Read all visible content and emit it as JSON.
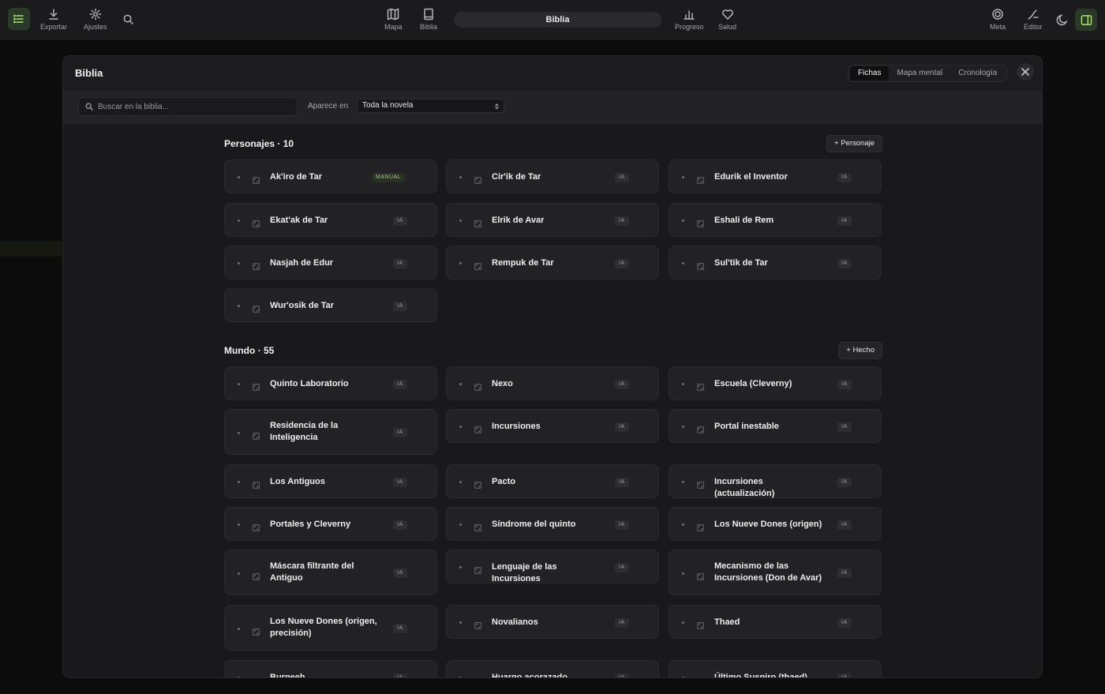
{
  "toolbar": {
    "export_label": "Exportar",
    "settings_label": "Ajustes",
    "map_label": "Mapa",
    "bible_label": "Biblia",
    "document_title": "Biblia",
    "progress_label": "Progreso",
    "health_label": "Salud",
    "goal_label": "Meta",
    "editor_label": "Editor"
  },
  "modal": {
    "title": "Biblia",
    "tabs": [
      "Fichas",
      "Mapa mental",
      "Cronología"
    ],
    "active_tab": "Fichas",
    "search_placeholder": "Buscar en la biblia...",
    "appears_in_label": "Aparece en",
    "appears_in_value": "Toda la novela"
  },
  "sections": [
    {
      "title": "Personajes · 10",
      "add_label": "+ Personaje",
      "cards": [
        {
          "name": "Ak'iro de Tar",
          "badge": "MANUAL"
        },
        {
          "name": "Cir'ik de Tar",
          "badge": "IA"
        },
        {
          "name": "Edurik el Inventor",
          "badge": "IA"
        },
        {
          "name": "Ekat'ak de Tar",
          "badge": "IA"
        },
        {
          "name": "Elrik de Avar",
          "badge": "IA"
        },
        {
          "name": "Eshali de Rem",
          "badge": "IA"
        },
        {
          "name": "Nasjah de Edur",
          "badge": "IA"
        },
        {
          "name": "Rempuk de Tar",
          "badge": "IA"
        },
        {
          "name": "Sul'tik de Tar",
          "badge": "IA"
        },
        {
          "name": "Wur'osik de Tar",
          "badge": "IA"
        }
      ]
    },
    {
      "title": "Mundo · 55",
      "add_label": "+ Hecho",
      "cards": [
        {
          "name": "Quinto Laboratorio",
          "badge": "IA"
        },
        {
          "name": "Nexo",
          "badge": "IA"
        },
        {
          "name": "Escuela (Cleverny)",
          "badge": "IA"
        },
        {
          "name": "Residencia de la Inteligencia",
          "badge": "IA"
        },
        {
          "name": "Incursiones",
          "badge": "IA"
        },
        {
          "name": "Portal inestable",
          "badge": "IA"
        },
        {
          "name": "Los Antiguos",
          "badge": "IA"
        },
        {
          "name": "Pacto",
          "badge": "IA"
        },
        {
          "name": "Incursiones (actualización)",
          "badge": "IA"
        },
        {
          "name": "Portales y Cleverny",
          "badge": "IA"
        },
        {
          "name": "Síndrome del quinto",
          "badge": "IA"
        },
        {
          "name": "Los Nueve Dones (origen)",
          "badge": "IA"
        },
        {
          "name": "Máscara filtrante del Antiguo",
          "badge": "IA"
        },
        {
          "name": "Lenguaje de las Incursiones",
          "badge": "IA"
        },
        {
          "name": "Mecanismo de las Incursiones (Don de Avar)",
          "badge": "IA"
        },
        {
          "name": "Los Nueve Dones (origen, precisión)",
          "badge": "IA"
        },
        {
          "name": "Novalianos",
          "badge": "IA"
        },
        {
          "name": "Thaed",
          "badge": "IA"
        },
        {
          "name": "Burpeeh",
          "badge": "IA"
        },
        {
          "name": "Huargo acorazado",
          "badge": "IA"
        },
        {
          "name": "Último Suspiro (thaed)",
          "badge": "IA"
        }
      ]
    }
  ]
}
